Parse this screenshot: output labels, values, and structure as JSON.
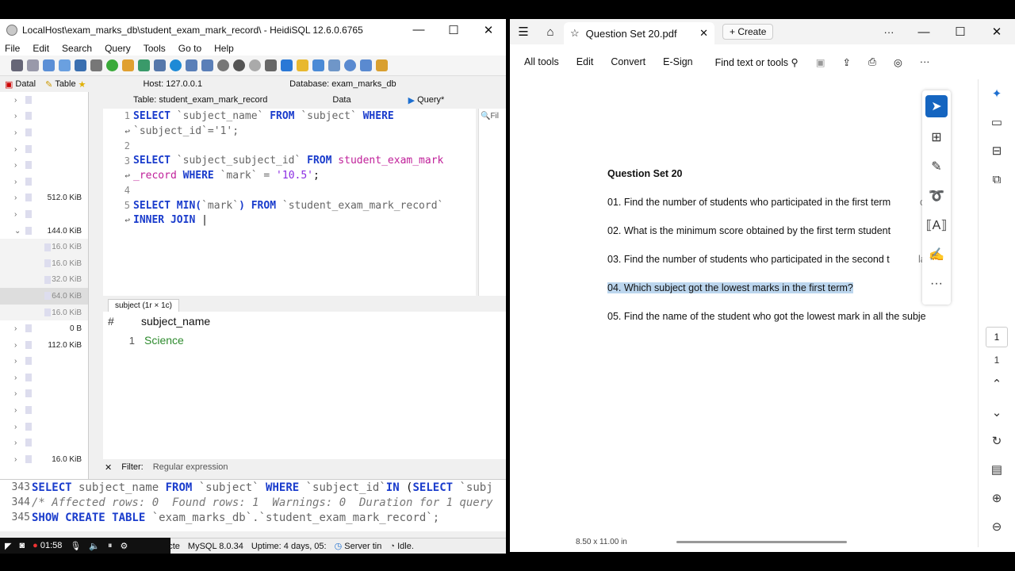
{
  "heidisql": {
    "title": "LocalHost\\exam_marks_db\\student_exam_mark_record\\ - HeidiSQL 12.6.0.6765",
    "window_controls": [
      "—",
      "☐",
      "✕"
    ],
    "menu": [
      "File",
      "Edit",
      "Search",
      "Query",
      "Tools",
      "Go to",
      "Help"
    ],
    "tabs1": {
      "database": "Datal",
      "table": "Table",
      "host": "Host: 127.0.0.1",
      "db": "Database: exam_marks_db"
    },
    "tabs2": {
      "table": "Table: student_exam_mark_record",
      "data": "Data",
      "query": "Query*"
    },
    "tree": [
      {
        "size": "",
        "sub": false
      },
      {
        "size": "",
        "sub": false
      },
      {
        "size": "",
        "sub": false
      },
      {
        "size": "",
        "sub": false
      },
      {
        "size": "",
        "sub": false
      },
      {
        "size": "",
        "sub": false
      },
      {
        "size": "512.0 KiB",
        "sub": false
      },
      {
        "size": "",
        "sub": false
      },
      {
        "size": "144.0 KiB",
        "sub": false,
        "expanded": true
      },
      {
        "size": "16.0 KiB",
        "sub": true
      },
      {
        "size": "16.0 KiB",
        "sub": true
      },
      {
        "size": "32.0 KiB",
        "sub": true
      },
      {
        "size": "64.0 KiB",
        "sub": true,
        "selected": true
      },
      {
        "size": "16.0 KiB",
        "sub": true
      },
      {
        "size": "0 B",
        "sub": false
      },
      {
        "size": "112.0 KiB",
        "sub": false
      },
      {
        "size": "",
        "sub": false
      },
      {
        "size": "",
        "sub": false
      },
      {
        "size": "",
        "sub": false
      },
      {
        "size": "",
        "sub": false
      },
      {
        "size": "",
        "sub": false
      },
      {
        "size": "",
        "sub": false
      },
      {
        "size": "16.0 KiB",
        "sub": false
      }
    ],
    "editor": {
      "l1_num": "1",
      "l1": [
        "SELECT",
        " `subject_name` ",
        "FROM",
        " `subject` ",
        "WHERE"
      ],
      "l1b": "`subject_id`='1';",
      "l2_num": "2",
      "l3_num": "3",
      "l3": [
        "SELECT",
        " `subject_subject_id` ",
        "FROM",
        " ",
        "student_exam_mark"
      ],
      "l3b": [
        "_record",
        " ",
        "WHERE",
        " `mark` = ",
        "'10.5'",
        ";"
      ],
      "l4_num": "4",
      "l5_num": "5",
      "l5": [
        "SELECT",
        " ",
        "MIN(",
        "`mark`",
        ")",
        " ",
        "FROM",
        " `student_exam_mark_record`"
      ],
      "l5b": [
        "INNER JOIN",
        " |"
      ],
      "filter_tab": "Fil"
    },
    "result": {
      "tab": "subject (1r × 1c)",
      "header_hash": "#",
      "column": "subject_name",
      "rows": [
        {
          "n": "1",
          "value": "Science"
        }
      ]
    },
    "filter": {
      "close": "✕",
      "label": "Filter:",
      "placeholder": "Regular expression"
    },
    "log": [
      {
        "n": "343",
        "text": [
          "SELECT",
          " subject_name ",
          "FROM",
          " `subject` ",
          "WHERE",
          " `subject_id`",
          "IN",
          " (",
          "SELECT",
          " `subj"
        ]
      },
      {
        "n": "344",
        "comment": "/* Affected rows: 0  Found rows: 1  Warnings: 0  Duration for 1 query"
      },
      {
        "n": "345",
        "text": [
          "SHOW CREATE TABLE",
          " `exam_marks_db`.`student_exam_mark_record`;"
        ]
      }
    ],
    "status": {
      "conn": "necte",
      "mysql": "MySQL 8.0.34",
      "uptime": "Uptime: 4 days, 05:",
      "server": "Server tin",
      "idle": "Idle."
    },
    "recorder_time": "01:58"
  },
  "pdf": {
    "tab_title": "Question Set 20.pdf",
    "create": "Create",
    "more": "···",
    "window_controls": [
      "—",
      "☐",
      "✕"
    ],
    "tools": [
      "All tools",
      "Edit",
      "Convert",
      "E-Sign"
    ],
    "find": "Find text or tools",
    "heading": "Question Set 20",
    "questions": [
      "01. Find the number of students who participated in the first term",
      "02. What is the minimum score obtained by the first term student",
      "03. Find the number of students who participated in the second t",
      "04. Which subject got the lowest marks in the first term?",
      "05. Find the name of the student who got the lowest mark in all the subje"
    ],
    "q_tail": [
      "ce",
      "",
      "lat",
      "",
      ""
    ],
    "page_current": "1",
    "page_total": "1",
    "page_size": "8.50 x 11.00 in",
    "accent": "#1565c0",
    "highlight": "#bcd6ee"
  }
}
